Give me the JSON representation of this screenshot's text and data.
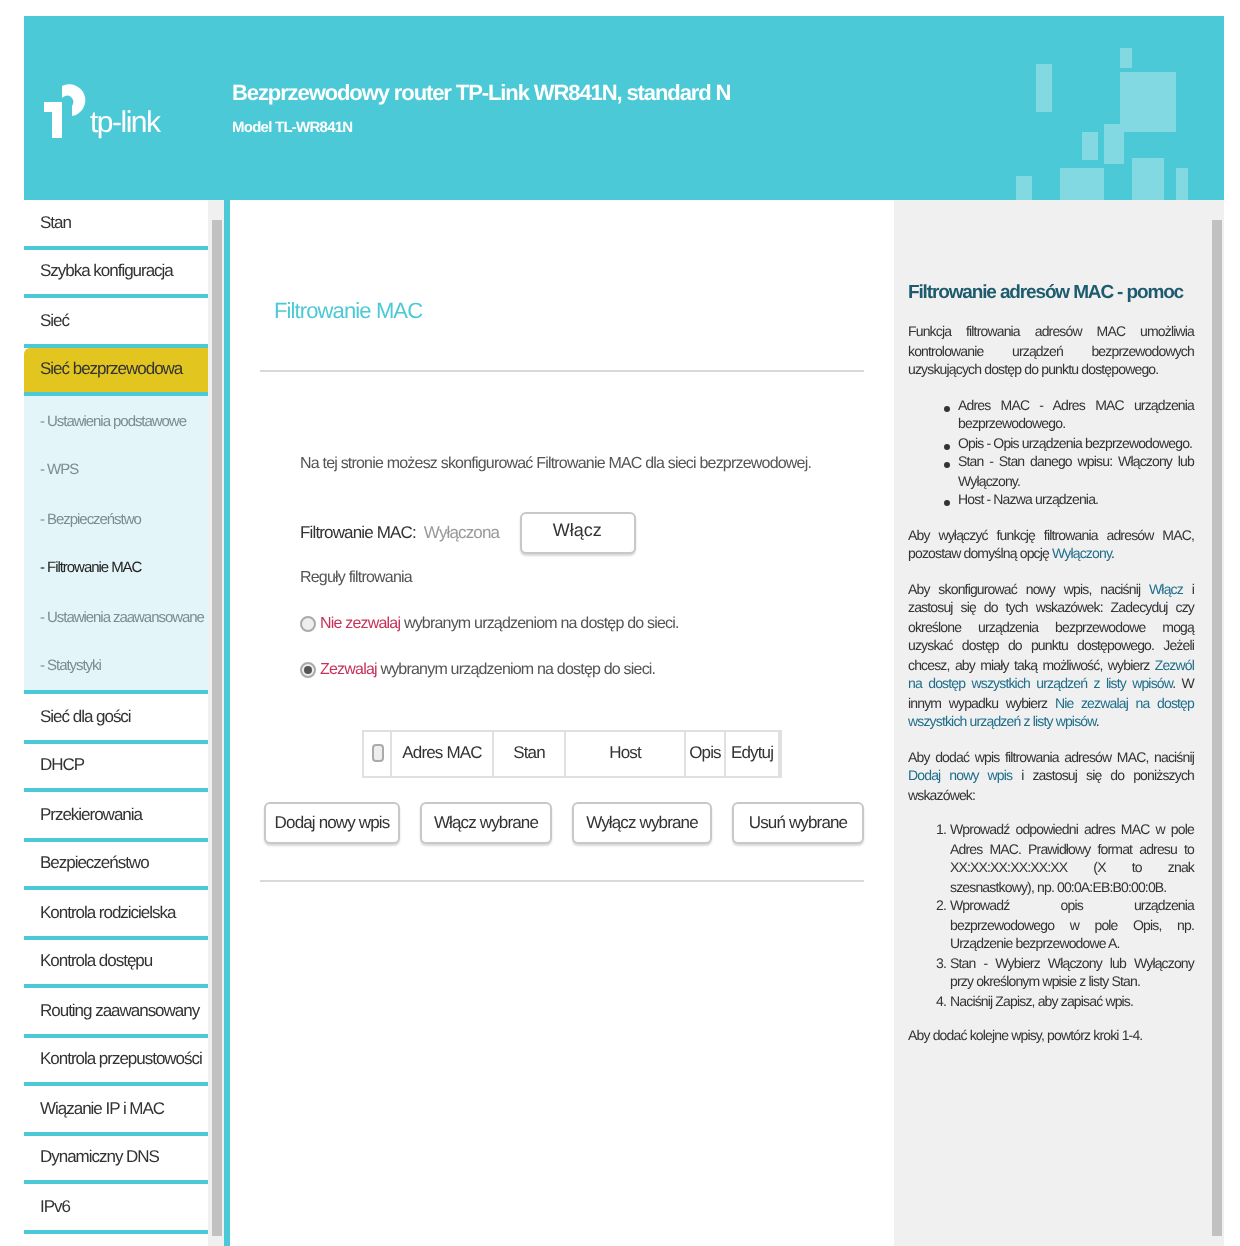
{
  "header": {
    "logo_text": "tp-link",
    "title": "Bezprzewodowy router TP-Link WR841N, standard N",
    "model": "Model TL-WR841N"
  },
  "sidebar": {
    "items": [
      {
        "label": "Stan",
        "selected": false
      },
      {
        "label": "Szybka konfiguracja",
        "selected": false
      },
      {
        "label": "Sieć",
        "selected": false
      },
      {
        "label": "Sieć bezprzewodowa",
        "selected": true,
        "expanded": true,
        "children": [
          {
            "label": "- Ustawienia podstawowe",
            "selected": false
          },
          {
            "label": "- WPS",
            "selected": false
          },
          {
            "label": "- Bezpieczeństwo",
            "selected": false
          },
          {
            "label": "- Filtrowanie MAC",
            "selected": true
          },
          {
            "label": "- Ustawienia zaawansowane",
            "selected": false
          },
          {
            "label": "- Statystyki",
            "selected": false
          }
        ]
      },
      {
        "label": "Sieć dla gości",
        "selected": false
      },
      {
        "label": "DHCP",
        "selected": false
      },
      {
        "label": "Przekierowania",
        "selected": false
      },
      {
        "label": "Bezpieczeństwo",
        "selected": false
      },
      {
        "label": "Kontrola rodzicielska",
        "selected": false
      },
      {
        "label": "Kontrola dostępu",
        "selected": false
      },
      {
        "label": "Routing zaawansowany",
        "selected": false
      },
      {
        "label": "Kontrola przepustowości",
        "selected": false
      },
      {
        "label": "Wiązanie IP i MAC",
        "selected": false
      },
      {
        "label": "Dynamiczny DNS",
        "selected": false
      },
      {
        "label": "IPv6",
        "selected": false
      }
    ]
  },
  "main": {
    "title": "Filtrowanie MAC",
    "intro": "Na tej stronie możesz skonfigurować Filtrowanie MAC dla sieci bezprzewodowej.",
    "filter_label": "Filtrowanie MAC:",
    "filter_status": "Wyłączona",
    "toggle_button": "Włącz",
    "rules_label": "Reguły filtrowania",
    "rules": [
      {
        "highlight": "Nie zezwalaj",
        "rest": "wybranym urządzeniom na dostęp do sieci.",
        "selected": false,
        "color": "#c8325a"
      },
      {
        "highlight": "Zezwalaj",
        "rest": "wybranym urządzeniom na dostęp do sieci.",
        "selected": true,
        "color": "#c8325a"
      }
    ],
    "table": {
      "select_all": {
        "checked": false
      },
      "columns": [
        "Adres MAC",
        "Stan",
        "Host",
        "Opis",
        "Edytuj"
      ]
    },
    "buttons": [
      "Dodaj nowy wpis",
      "Włącz wybrane",
      "Wyłącz wybrane",
      "Usuń wybrane"
    ]
  },
  "help": {
    "title": "Filtrowanie adresów MAC - pomoc",
    "blocks": [
      {
        "kind": "paragraph",
        "parts": [
          {
            "kind": "text",
            "text": "Funkcja filtrowania adresów MAC umożliwia kontrolowanie urządzeń bezprzewodowych uzyskujących dostęp do punktu dostępowego."
          }
        ]
      },
      {
        "kind": "bullets",
        "items": [
          "Adres MAC - Adres MAC urządzenia bezprzewodowego.",
          "Opis - Opis urządzenia bezprzewodowego.",
          "Stan - Stan danego wpisu: Włączony lub Wyłączony.",
          "Host - Nazwa urządzenia."
        ]
      },
      {
        "kind": "paragraph",
        "parts": [
          {
            "kind": "text",
            "text": "Aby wyłączyć funkcję filtrowania adresów MAC, pozostaw domyślną opcję "
          },
          {
            "kind": "term",
            "text": "Wyłączony"
          },
          {
            "kind": "text",
            "text": "."
          }
        ]
      },
      {
        "kind": "paragraph",
        "parts": [
          {
            "kind": "text",
            "text": "Aby skonfigurować nowy wpis, naciśnij "
          },
          {
            "kind": "term",
            "text": "Włącz"
          },
          {
            "kind": "text",
            "text": " i zastosuj się do tych wskazówek: Zadecyduj czy określone urządzenia bezprzewodowe mogą uzyskać dostęp do punktu dostępowego. Jeżeli chcesz, aby miały taką możliwość, wybierz "
          },
          {
            "kind": "term",
            "text": "Zezwól na dostęp wszystkich urządzeń z listy wpisów"
          },
          {
            "kind": "text",
            "text": ". W innym wypadku wybierz "
          },
          {
            "kind": "term",
            "text": "Nie zezwalaj na dostęp wszystkich urządzeń z listy wpisów"
          },
          {
            "kind": "text",
            "text": "."
          }
        ]
      },
      {
        "kind": "paragraph",
        "parts": [
          {
            "kind": "text",
            "text": "Aby dodać wpis filtrowania adresów MAC, naciśnij "
          },
          {
            "kind": "term",
            "text": "Dodaj nowy wpis"
          },
          {
            "kind": "text",
            "text": " i zastosuj się do poniższych wskazówek:"
          }
        ]
      },
      {
        "kind": "numbered",
        "items": [
          {
            "number": "1.",
            "text": "Wprowadź odpowiedni adres MAC w pole Adres MAC. Prawidłowy format adresu to XX:XX:XX:XX:XX:XX (X to znak szesnastkowy), np. 00:0A:EB:B0:00:0B."
          },
          {
            "number": "2.",
            "text": "Wprowadź opis urządzenia bezprzewodowego w pole Opis, np. Urządzenie bezprzewodowe A."
          },
          {
            "number": "3.",
            "text": "Stan - Wybierz Włączony lub Wyłączony przy określonym wpisie z listy Stan."
          },
          {
            "number": "4.",
            "text": "Naciśnij Zapisz, aby zapisać wpis."
          }
        ]
      },
      {
        "kind": "paragraph",
        "parts": [
          {
            "kind": "text",
            "text": "Aby dodać kolejne wpisy, powtórz kroki 1-4."
          }
        ]
      }
    ]
  }
}
